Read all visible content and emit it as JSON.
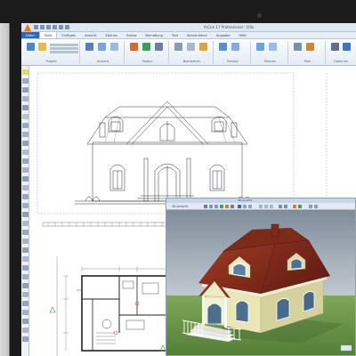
{
  "titlebar": {
    "title": "ArCon 17 Professional - Villa"
  },
  "tabs": [
    {
      "label": "Datei"
    },
    {
      "label": "Start"
    },
    {
      "label": "Einfügen"
    },
    {
      "label": "Ansicht"
    },
    {
      "label": "Ebenen"
    },
    {
      "label": "Extras"
    },
    {
      "label": "Bemaßung"
    },
    {
      "label": "Text"
    },
    {
      "label": "Konstruktion"
    },
    {
      "label": "Ausgabe"
    },
    {
      "label": "Hilfe"
    }
  ],
  "ribbon": {
    "groups": [
      {
        "label": "Projekt"
      },
      {
        "label": "Ansicht"
      },
      {
        "label": "Modus"
      },
      {
        "label": "Bearbeiten"
      },
      {
        "label": "Fenster"
      },
      {
        "label": "Ebenen"
      },
      {
        "label": "Plan"
      },
      {
        "label": "Optionen"
      }
    ]
  },
  "view3d": {
    "tab_label": "3D-Ansicht",
    "title": "3D-Ansicht"
  },
  "colors": {
    "roof": "#8a2e1e",
    "wall": "#e9e6b8",
    "grass": "#6f9a4c",
    "ribbon_blue": "#2f69b3",
    "accent_orange": "#e7781c",
    "drawing_red": "#d23b2e",
    "drawing_green": "#2e9b43"
  }
}
